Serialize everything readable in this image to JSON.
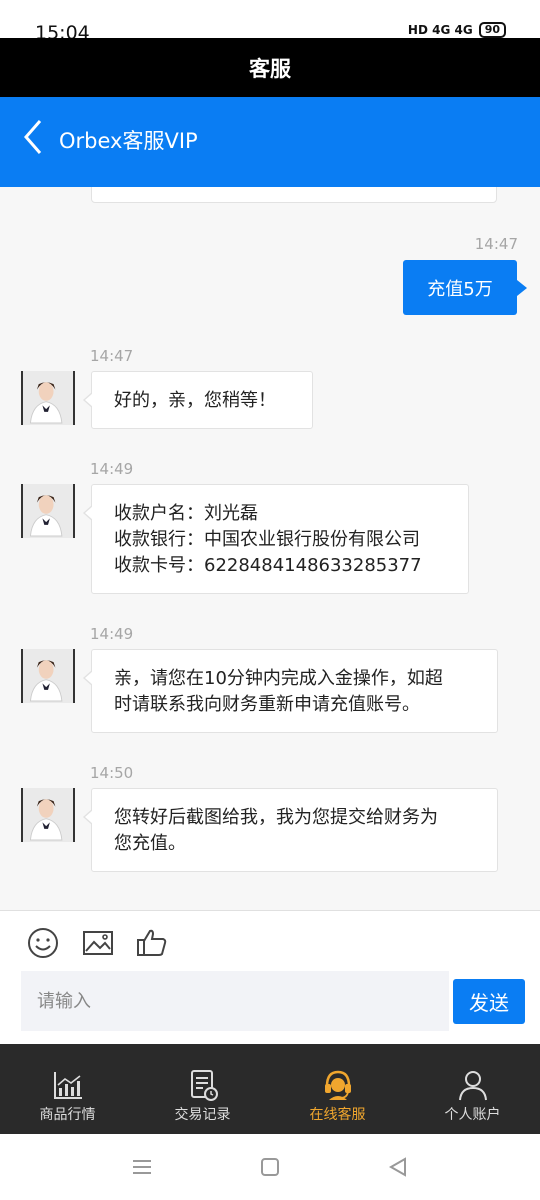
{
  "status_bar": {
    "time": "15:04",
    "network": "HD 4G 4G",
    "battery": "90"
  },
  "title_bar": {
    "title": "客服"
  },
  "header": {
    "title": "Orbex客服VIP"
  },
  "messages": [
    {
      "time": "14:47",
      "direction": "out",
      "text": "充值5万"
    },
    {
      "time": "14:47",
      "direction": "in",
      "lines": [
        "好的，亲，您稍等！"
      ]
    },
    {
      "time": "14:49",
      "direction": "in",
      "lines": [
        "收款户名：刘光磊",
        "收款银行：中国农业银行股份有限公司",
        "收款卡号：6228484148633285377"
      ]
    },
    {
      "time": "14:49",
      "direction": "in",
      "lines": [
        "亲，请您在10分钟内完成入金操作，如超",
        "时请联系我向财务重新申请充值账号。"
      ]
    },
    {
      "time": "14:50",
      "direction": "in",
      "lines": [
        "您转好后截图给我，我为您提交给财务为",
        "您充值。"
      ]
    }
  ],
  "input": {
    "placeholder": "请输入",
    "send_label": "发送"
  },
  "tabs": [
    {
      "label": "商品行情",
      "icon": "chart-icon"
    },
    {
      "label": "交易记录",
      "icon": "records-icon"
    },
    {
      "label": "在线客服",
      "icon": "headset-icon",
      "active": true
    },
    {
      "label": "个人账户",
      "icon": "person-icon"
    }
  ],
  "colors": {
    "accent": "#0a7df3",
    "tab_active": "#f0a62e",
    "tab_bg": "#2a2a2a"
  }
}
